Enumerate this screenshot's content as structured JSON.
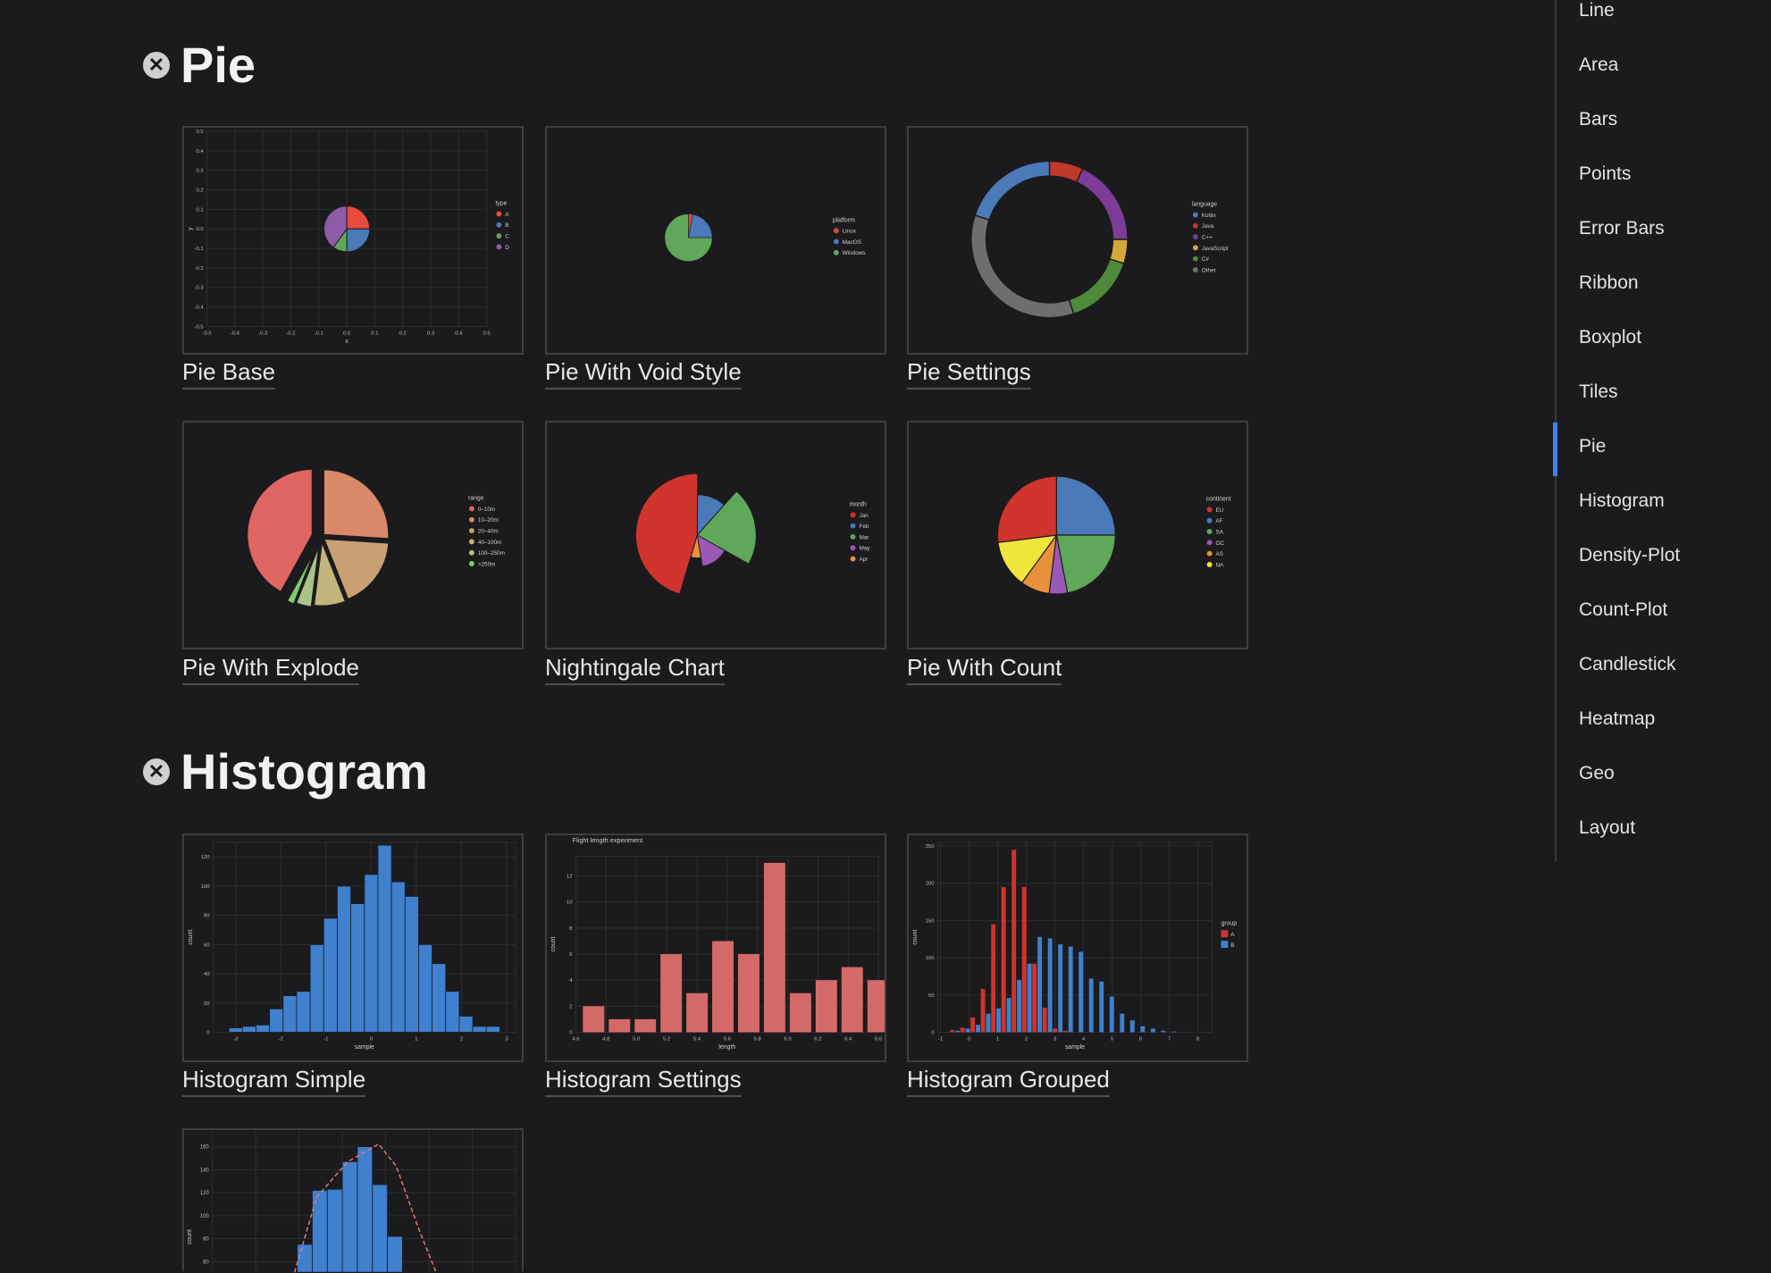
{
  "sections": {
    "pie": {
      "title": "Pie"
    },
    "histogram": {
      "title": "Histogram"
    }
  },
  "cards": {
    "pie_base": "Pie Base",
    "pie_void": "Pie With Void Style",
    "pie_settings": "Pie Settings",
    "pie_explode": "Pie With Explode",
    "nightingale": "Nightingale Chart",
    "pie_count": "Pie With Count",
    "hist_simple": "Histogram Simple",
    "hist_settings": "Histogram Settings",
    "hist_grouped": "Histogram Grouped"
  },
  "sidebar": {
    "items": [
      "Line",
      "Area",
      "Bars",
      "Points",
      "Error Bars",
      "Ribbon",
      "Boxplot",
      "Tiles",
      "Pie",
      "Histogram",
      "Density-Plot",
      "Count-Plot",
      "Candlestick",
      "Heatmap",
      "Geo",
      "Layout"
    ],
    "active": "Pie",
    "accent": "#3b82f6"
  },
  "icons": {
    "section_close": "close-circle-icon"
  },
  "chart_data": [
    {
      "id": "pie_base",
      "type": "pie",
      "values": [
        25,
        25,
        10,
        40
      ],
      "legend_title": "type",
      "legend": [
        "A",
        "B",
        "C",
        "D"
      ],
      "colors": [
        "#e74c3c",
        "#4a7ab8",
        "#5fa85a",
        "#8e5ba6"
      ],
      "xlabel": "x",
      "ylabel": "y",
      "xlim": [
        -0.5,
        0.5
      ],
      "ylim": [
        -0.5,
        0.5
      ],
      "xticks": [
        "-0.5",
        "-0.4",
        "-0.3",
        "-0.2",
        "-0.1",
        "0.0",
        "0.1",
        "0.2",
        "0.3",
        "0.4",
        "0.5"
      ],
      "yticks": [
        "0.5",
        "0.4",
        "0.3",
        "0.2",
        "0.1",
        "0.0",
        "-0.1",
        "-0.2",
        "-0.3",
        "-0.4",
        "-0.5"
      ]
    },
    {
      "id": "pie_void",
      "type": "pie",
      "values": [
        3,
        22,
        75
      ],
      "legend_title": "platform",
      "legend": [
        "Linux",
        "MacOS",
        "Windows"
      ],
      "colors": [
        "#d94a3f",
        "#4a7ab8",
        "#5fa85a"
      ]
    },
    {
      "id": "pie_settings",
      "type": "pie",
      "values": [
        20,
        7,
        18,
        5,
        15,
        35
      ],
      "legend_title": "language",
      "legend": [
        "Kotlin",
        "Java",
        "C++",
        "JavaScript",
        "C#",
        "Other"
      ],
      "order": [
        "Java",
        "C++",
        "JavaScript",
        "C#",
        "Other",
        "Kotlin"
      ],
      "colors": [
        "#4a7ab8",
        "#c0392b",
        "#7d3c98",
        "#d4a93c",
        "#4f8a3c",
        "#6e6e6e"
      ]
    },
    {
      "id": "pie_explode",
      "type": "pie",
      "values": [
        21,
        13,
        9,
        4,
        2,
        1
      ],
      "legend_title": "range",
      "legend": [
        "0–10m",
        "10–20m",
        "20–40m",
        "40–100m",
        "100–250m",
        ">250m"
      ],
      "colors": [
        "#e06663",
        "#d9886a",
        "#c9a071",
        "#c2b57a",
        "#a9c486",
        "#7fcc6e"
      ]
    },
    {
      "id": "nightingale",
      "type": "pie",
      "values": [
        22,
        16,
        30,
        12,
        6
      ],
      "legend_title": "month",
      "legend": [
        "Jan",
        "Feb",
        "Mar",
        "May",
        "Apr"
      ],
      "colors": [
        "#d0342c",
        "#4a7ab8",
        "#5fa85a",
        "#9b59b6",
        "#e8913d"
      ]
    },
    {
      "id": "pie_count",
      "type": "pie",
      "values": [
        27,
        25,
        22,
        5,
        8,
        13
      ],
      "legend_title": "continent",
      "legend": [
        "EU",
        "AF",
        "SA",
        "OC",
        "AS",
        "NA"
      ],
      "order": [
        "AF",
        "SA",
        "OC",
        "AS",
        "NA",
        "EU"
      ],
      "colors": [
        "#d0342c",
        "#4a7ab8",
        "#5fa85a",
        "#9b59b6",
        "#e8913d",
        "#f1e63c"
      ]
    },
    {
      "id": "hist_simple",
      "type": "bar",
      "x": [
        -3,
        -2.7,
        -2.4,
        -2.1,
        -1.8,
        -1.5,
        -1.2,
        -0.9,
        -0.6,
        -0.3,
        0,
        0.3,
        0.6,
        0.9,
        1.2,
        1.5,
        1.8,
        2.1,
        2.4,
        2.7
      ],
      "values": [
        3,
        4,
        5,
        16,
        25,
        28,
        60,
        78,
        100,
        88,
        108,
        128,
        103,
        93,
        60,
        47,
        28,
        11,
        4,
        4
      ],
      "color": "#3f80cf",
      "xlabel": "sample",
      "ylabel": "count",
      "xlim": [
        -3.3,
        3
      ],
      "ylim": [
        0,
        130
      ],
      "xticks": [
        "-3",
        "-2",
        "-1",
        "0",
        "1",
        "2",
        "3"
      ],
      "yticks": [
        "0",
        "20",
        "40",
        "60",
        "80",
        "100",
        "120"
      ]
    },
    {
      "id": "hist_settings",
      "type": "bar",
      "title": "Flight length experiment",
      "x": [
        4.7,
        4.8,
        4.9,
        5.1,
        5.3,
        5.5,
        5.7,
        5.9,
        6.1,
        6.3,
        6.5
      ],
      "values": [
        2,
        1,
        1,
        6,
        3,
        7,
        6,
        13,
        3,
        4,
        5,
        4
      ],
      "color": "#d46a68",
      "xlabel": "length",
      "ylabel": "count",
      "xlim": [
        4.6,
        6.6
      ],
      "ylim": [
        0,
        13
      ],
      "xticks": [
        "4.6",
        "4.8",
        "5.0",
        "5.2",
        "5.4",
        "5.6",
        "5.8",
        "6.0",
        "6.2",
        "6.4",
        "6.6"
      ],
      "yticks": [
        "0",
        "2",
        "4",
        "6",
        "8",
        "10",
        "12"
      ]
    },
    {
      "id": "hist_grouped",
      "type": "bar",
      "legend_title": "group",
      "series": [
        {
          "name": "A",
          "color": "#d0342c",
          "values": [
            3,
            6,
            20,
            58,
            145,
            195,
            245,
            195,
            92,
            33,
            5,
            2,
            0,
            0,
            0,
            0,
            0,
            0,
            0,
            0,
            0,
            0
          ]
        },
        {
          "name": "B",
          "color": "#3f80cf",
          "values": [
            2,
            5,
            10,
            25,
            32,
            46,
            70,
            92,
            128,
            126,
            118,
            115,
            108,
            72,
            68,
            48,
            25,
            16,
            8,
            5,
            2,
            1
          ]
        }
      ],
      "xlabel": "sample",
      "ylabel": "count",
      "xlim": [
        -1,
        8.4
      ],
      "ylim": [
        0,
        255
      ],
      "xticks": [
        "-1",
        "0",
        "1",
        "2",
        "3",
        "4",
        "5",
        "6",
        "7",
        "8"
      ],
      "yticks": [
        "0",
        "50",
        "100",
        "150",
        "200",
        "250"
      ]
    },
    {
      "id": "hist_density",
      "type": "bar",
      "values": [
        75,
        122,
        123,
        147,
        160,
        127,
        82
      ],
      "color": "#3f80cf",
      "ylabel": "count",
      "yticks": [
        "60",
        "80",
        "100",
        "120",
        "140",
        "160"
      ]
    }
  ]
}
